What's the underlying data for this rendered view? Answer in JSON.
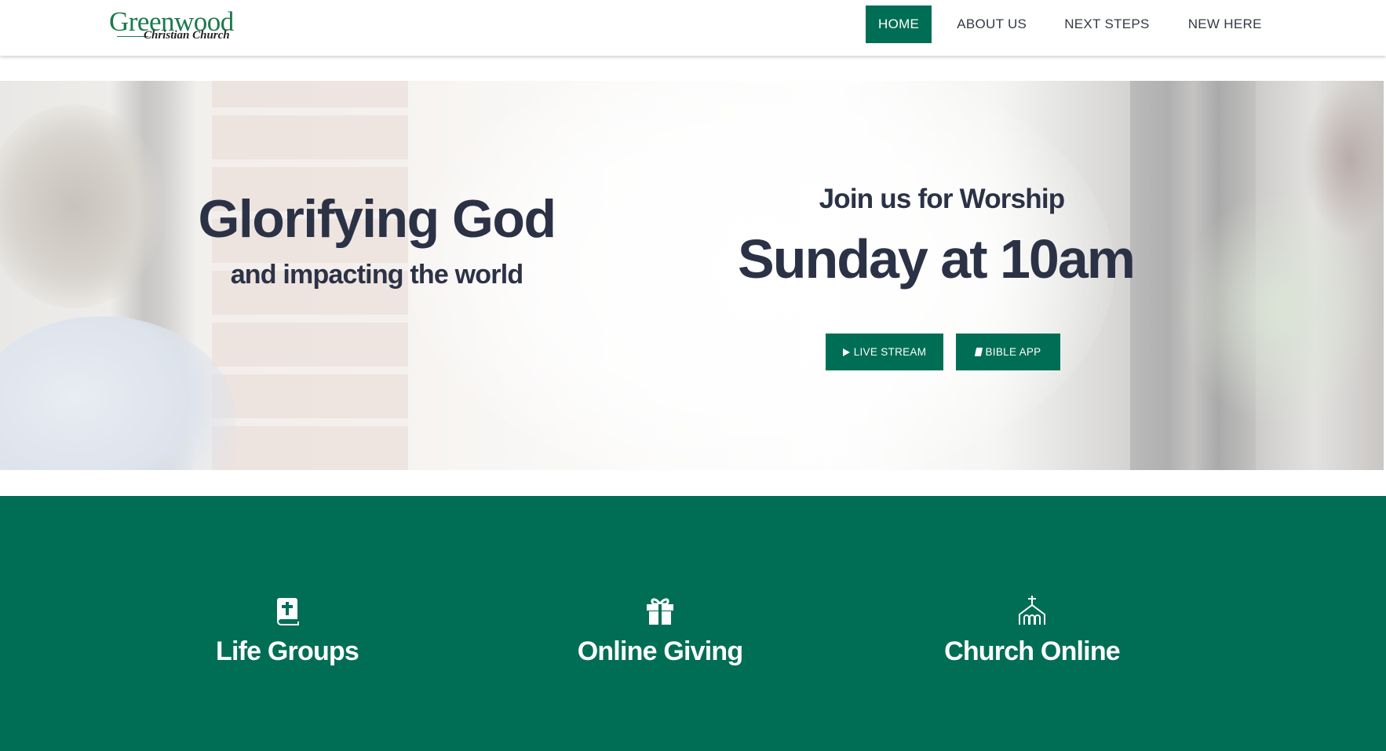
{
  "header": {
    "logo": {
      "main": "Greenwood",
      "sub": "Christian Church"
    },
    "nav": [
      {
        "label": "HOME",
        "active": true
      },
      {
        "label": "ABOUT US",
        "active": false
      },
      {
        "label": "NEXT STEPS",
        "active": false
      },
      {
        "label": "NEW HERE",
        "active": false
      }
    ]
  },
  "hero": {
    "title": "Glorifying God",
    "subtitle": "and impacting the world",
    "worship_intro": "Join us for Worship",
    "worship_time": "Sunday at 10am",
    "buttons": {
      "live_stream": {
        "label": "LIVE STREAM",
        "icon": "play-icon"
      },
      "bible_app": {
        "label": "BIBLE APP",
        "icon": "book-icon"
      }
    }
  },
  "features": [
    {
      "label": "Life Groups",
      "icon": "bible-cross-icon"
    },
    {
      "label": "Online Giving",
      "icon": "gift-icon"
    },
    {
      "label": "Church Online",
      "icon": "church-icon"
    }
  ],
  "colors": {
    "brand_green": "#006e55",
    "heading_navy": "#2c3246",
    "logo_green": "#1a7a4c"
  }
}
